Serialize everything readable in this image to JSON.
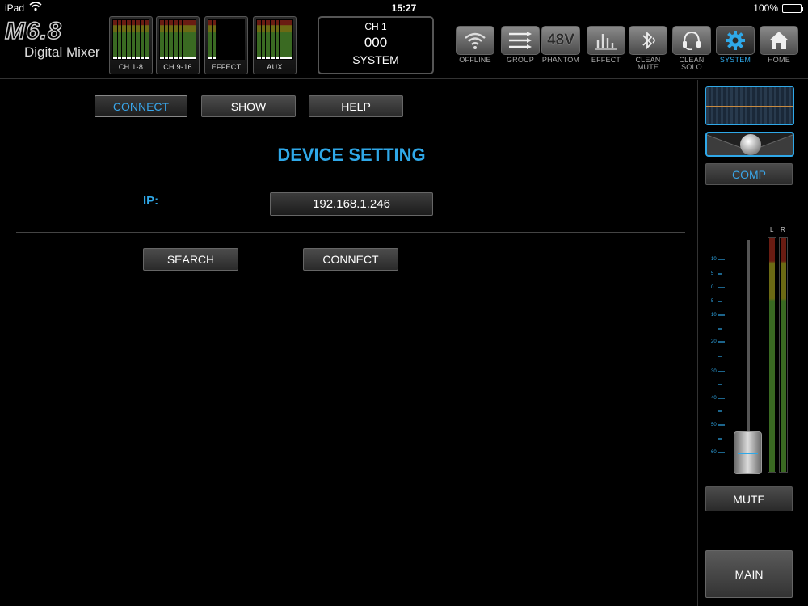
{
  "status_bar": {
    "carrier": "iPad",
    "time": "15:27",
    "battery": "100%"
  },
  "logo": {
    "model": "M6.8",
    "subtitle": "Digital Mixer"
  },
  "meters": [
    {
      "label": "CH 1-8"
    },
    {
      "label": "CH 9-16"
    },
    {
      "label": "EFFECT"
    },
    {
      "label": "AUX"
    }
  ],
  "channel_display": {
    "channel": "CH 1",
    "number": "000",
    "mode": "SYSTEM"
  },
  "nav": [
    {
      "label": "OFFLINE",
      "icon": "wifi-icon"
    },
    {
      "label": "GROUP",
      "icon": "group-icon"
    },
    {
      "label": "PHANTOM",
      "icon": "phantom-48v-icon",
      "glyph": "48V"
    },
    {
      "label": "EFFECT",
      "icon": "effect-icon"
    },
    {
      "label": "CLEAN",
      "label2": "MUTE",
      "icon": "bluetooth-mute-icon"
    },
    {
      "label": "CLEAN",
      "label2": "SOLO",
      "icon": "headset-icon"
    },
    {
      "label": "SYSTEM",
      "icon": "gear-icon"
    },
    {
      "label": "HOME",
      "icon": "home-icon"
    }
  ],
  "tabs": [
    {
      "label": "CONNECT"
    },
    {
      "label": "SHOW"
    },
    {
      "label": "HELP"
    }
  ],
  "device": {
    "title": "DEVICE SETTING",
    "ip_label": "IP:",
    "ip_value": "192.168.1.246",
    "search_label": "SEARCH",
    "connect_label": "CONNECT"
  },
  "right_panel": {
    "comp_label": "COMP",
    "scale": [
      "10",
      "5",
      "0",
      "5",
      "10",
      "20",
      "30",
      "40",
      "50",
      "60"
    ],
    "meter_left_label": "L",
    "meter_right_label": "R",
    "mute_label": "MUTE",
    "main_label": "MAIN"
  },
  "colors": {
    "accent": "#2fa8e8",
    "background": "#000000"
  }
}
